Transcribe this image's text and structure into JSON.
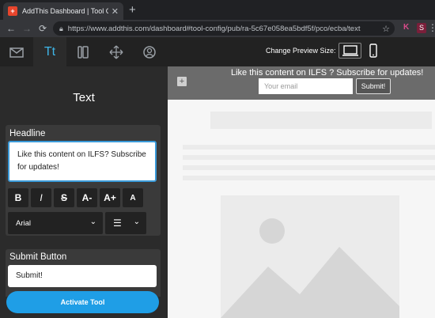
{
  "browser": {
    "tab_title": "AddThis Dashboard | Tool Gallery",
    "tab_favicon": "+",
    "url": "https://www.addthis.com/dashboard#tool-config/pub/ra-5c67e058ea5bdf5f/pco/ecba/text",
    "ext_k": "K",
    "ext_s": "S"
  },
  "toolbar": {
    "tabs": [
      "mail-icon",
      "text-icon",
      "layout-icon",
      "move-icon",
      "target-icon"
    ],
    "text_tab_label": "Tt"
  },
  "panel": {
    "title": "Text",
    "headline": {
      "label": "Headline",
      "value_line1": "Like this content on ILFS? Subscribe",
      "value_line2": "for updates!"
    },
    "format_buttons": [
      "B",
      "I",
      "S",
      "A-",
      "A+",
      "A"
    ],
    "font": "Arial",
    "submit": {
      "label": "Submit Button",
      "value": "Submit!"
    },
    "activate_label": "Activate Tool"
  },
  "preview": {
    "label": "Change Preview Size:",
    "banner_text": "Like this content on ILFS ? Subscribe for updates!",
    "email_placeholder": "Your email",
    "submit_label": "Submit!"
  },
  "colors": {
    "accent": "#3fb6e8",
    "activate": "#1f9ee6",
    "banner": "#6b6b6b"
  }
}
